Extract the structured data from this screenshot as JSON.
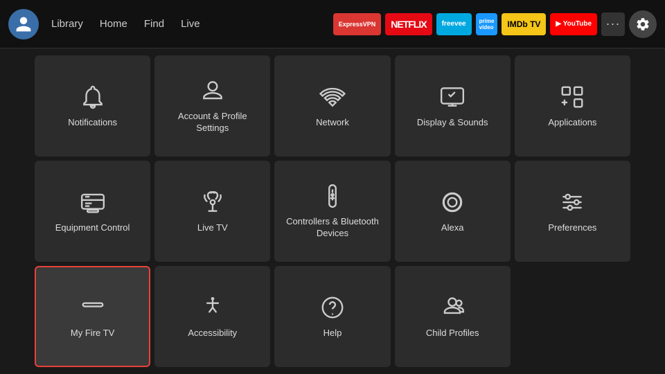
{
  "nav": {
    "links": [
      "Library",
      "Home",
      "Find",
      "Live"
    ],
    "apps": [
      {
        "label": "ExpressVPN",
        "class": "badge-expressvpn"
      },
      {
        "label": "NETFLIX",
        "class": "badge-netflix"
      },
      {
        "label": "freevee",
        "class": "badge-freevee"
      },
      {
        "label": "prime video",
        "class": "badge-prime"
      },
      {
        "label": "IMDb TV",
        "class": "badge-imdb"
      },
      {
        "label": "▶ YouTube",
        "class": "badge-youtube"
      }
    ],
    "more_label": "···",
    "gear_label": "Settings"
  },
  "grid": {
    "items": [
      {
        "id": "notifications",
        "label": "Notifications",
        "icon": "bell"
      },
      {
        "id": "account",
        "label": "Account & Profile Settings",
        "icon": "person"
      },
      {
        "id": "network",
        "label": "Network",
        "icon": "wifi"
      },
      {
        "id": "display-sounds",
        "label": "Display & Sounds",
        "icon": "display"
      },
      {
        "id": "applications",
        "label": "Applications",
        "icon": "apps"
      },
      {
        "id": "equipment",
        "label": "Equipment Control",
        "icon": "monitor"
      },
      {
        "id": "livetv",
        "label": "Live TV",
        "icon": "antenna"
      },
      {
        "id": "controllers",
        "label": "Controllers & Bluetooth Devices",
        "icon": "remote"
      },
      {
        "id": "alexa",
        "label": "Alexa",
        "icon": "alexa"
      },
      {
        "id": "preferences",
        "label": "Preferences",
        "icon": "sliders"
      },
      {
        "id": "myfiretv",
        "label": "My Fire TV",
        "icon": "firetv",
        "selected": true
      },
      {
        "id": "accessibility",
        "label": "Accessibility",
        "icon": "accessibility"
      },
      {
        "id": "help",
        "label": "Help",
        "icon": "help"
      },
      {
        "id": "childprofiles",
        "label": "Child Profiles",
        "icon": "child"
      }
    ]
  }
}
